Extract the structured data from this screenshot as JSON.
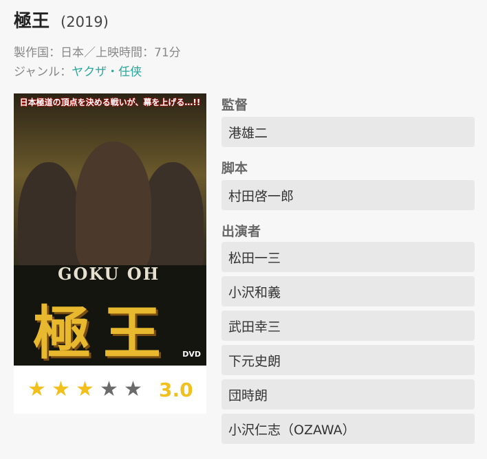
{
  "movie": {
    "title": "極王",
    "year": "(2019)",
    "production_label": "製作国：日本／上映時間：71分",
    "genre_label": "ジャンル：",
    "genre": "ヤクザ・任侠"
  },
  "poster": {
    "tagline": "日本極道の頂点を決める戦いが、幕を上げる…!!",
    "romaji": "GOKU OH",
    "kanji": "極王",
    "badge": "DVD"
  },
  "rating": {
    "score": "3.0",
    "stars": [
      1,
      1,
      1,
      0,
      0
    ]
  },
  "credits": {
    "director_label": "監督",
    "director": "港雄二",
    "writer_label": "脚本",
    "writer": "村田啓一郎",
    "cast_label": "出演者",
    "cast": [
      "松田一三",
      "小沢和義",
      "武田幸三",
      "下元史朗",
      "団時朗",
      "小沢仁志（OZAWA）"
    ]
  },
  "colors": {
    "accent": "#2aa79b",
    "star_on": "#f2c01d",
    "star_off": "#6b6b6b",
    "chip_bg": "#e8e8e8"
  }
}
